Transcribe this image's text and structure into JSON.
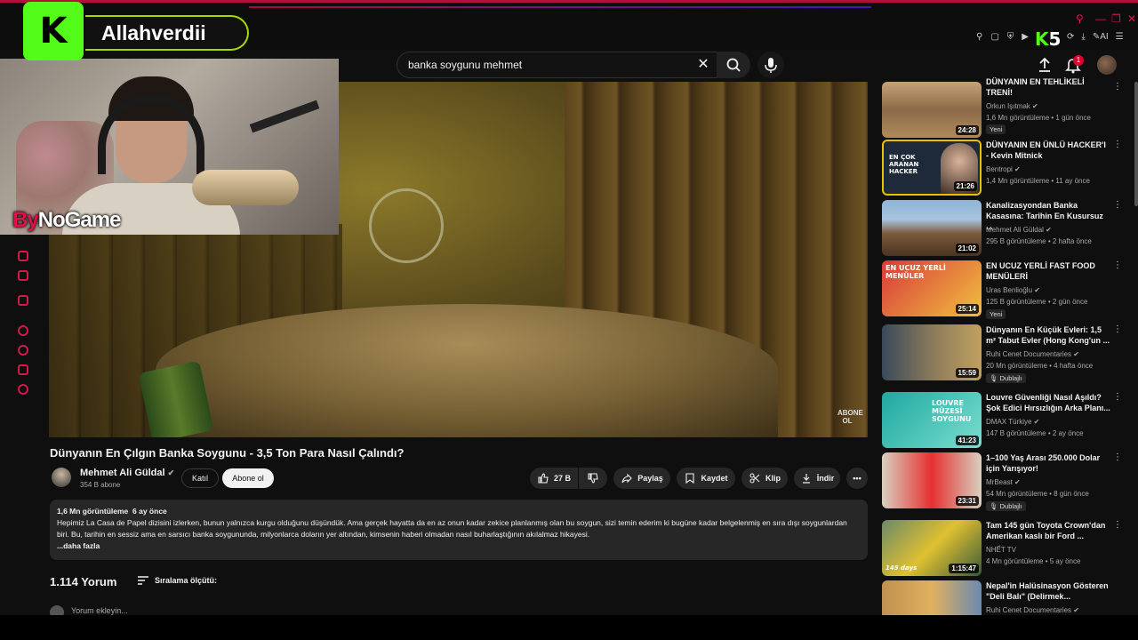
{
  "streamer": {
    "logo_letter": "K",
    "name": "Allahverdii",
    "brand_prefix": "By",
    "brand_name": "NoGame"
  },
  "kick_badge": {
    "letter": "K",
    "count": "5"
  },
  "search": {
    "query": "banka soygunu mehmet"
  },
  "notifications": {
    "count": "1"
  },
  "video": {
    "title": "Dünyanın En Çılgın Banka Soygunu - 3,5 Ton Para Nasıl Çalındı?",
    "watermark": "ABONE OL",
    "channel": "Mehmet Ali Güldal",
    "subscribers": "354 B abone",
    "join_label": "Katıl",
    "subscribe_label": "Abone ol",
    "likes": "27 B",
    "share_label": "Paylaş",
    "save_label": "Kaydet",
    "clip_label": "Klip",
    "download_label": "İndir"
  },
  "description": {
    "views": "1,6 Mn görüntüleme",
    "age": "6 ay önce",
    "text": "Hepimiz La Casa de Papel dizisini izlerken, bunun yalnızca kurgu olduğunu düşündük. Ama gerçek hayatta da en az onun kadar zekice planlanmış olan bu soygun, sizi temin ederim ki bugüne kadar belgelenmiş en sıra dışı soygunlardan biri. Bu, tarihin en sessiz ama en sarsıcı banka soygununda, milyonlarca doların yer altından, kimsenin haberi olmadan nasıl buharlaştığının akılalmaz hikayesi.",
    "more_label": "...daha fazla"
  },
  "comments": {
    "count_label": "1.114 Yorum",
    "sort_label": "Sıralama ölçütü:",
    "add_placeholder": "Yorum ekleyin..."
  },
  "recommendations": [
    {
      "title": "DÜNYANIN EN TEHLİKELİ TRENİ!",
      "channel": "Orkun Işıtmak",
      "stats": "1,6 Mn görüntüleme • 1 gün önce",
      "duration": "24:28",
      "tag": "Yeni",
      "thumb_text": ""
    },
    {
      "title": "DÜNYANIN EN ÜNLÜ HACKER'I - Kevin Mitnick",
      "channel": "Bentropi",
      "stats": "1,4 Mn görüntüleme • 11 ay önce",
      "duration": "21:26",
      "tag": "",
      "thumb_text": "EN ÇOK ARANAN HACKER"
    },
    {
      "title": "Kanalizasyondan Banka Kasasına: Tarihin En Kusursuz ...",
      "channel": "Mehmet Ali Güldal",
      "stats": "295 B görüntüleme • 2 hafta önce",
      "duration": "21:02",
      "tag": "",
      "thumb_text": ""
    },
    {
      "title": "EN UCUZ YERLİ FAST FOOD MENÜLERİ",
      "channel": "Uras Benlioğlu",
      "stats": "125 B görüntüleme • 2 gün önce",
      "duration": "25:14",
      "tag": "Yeni",
      "thumb_text": "EN UCUZ YERLİ MENÜLER"
    },
    {
      "title": "Dünyanın En Küçük Evleri: 1,5 m² Tabut Evler (Hong Kong'un ...",
      "channel": "Ruhi Cenet Documentaries",
      "stats": "20 Mn görüntüleme • 4 hafta önce",
      "duration": "15:59",
      "tag": "Dublajlı",
      "thumb_text": ""
    },
    {
      "title": "Louvre Güvenliği Nasıl Aşıldı? Şok Edici Hırsızlığın Arka Planı...",
      "channel": "DMAX Türkiye",
      "stats": "147 B görüntüleme • 2 ay önce",
      "duration": "41:23",
      "tag": "",
      "thumb_text": "LOUVRE MÜZESİ SOYGUNU"
    },
    {
      "title": "1–100 Yaş Arası 250.000 Dolar için Yarışıyor!",
      "channel": "MrBeast",
      "stats": "54 Mn görüntüleme • 8 gün önce",
      "duration": "23:31",
      "tag": "Dublajlı",
      "thumb_text": ""
    },
    {
      "title": "Tam 145 gün Toyota Crown'dan Amerikan kaslı bir Ford ...",
      "channel": "NHẾT TV",
      "stats": "4 Mn görüntüleme • 5 ay önce",
      "duration": "1:15:47",
      "tag": "",
      "thumb_text": "145 days"
    },
    {
      "title": "Nepal'in Halüsinasyon Gösteren \"Deli Balı\" (Delirmek...",
      "channel": "Ruhi Cenet Documentaries",
      "stats": "",
      "duration": "",
      "tag": "",
      "thumb_text": ""
    }
  ],
  "colors": {
    "accent_red": "#e0104a",
    "kick_green": "#53fc18",
    "bg": "#0f0f0f",
    "pill_bg": "#272727"
  }
}
